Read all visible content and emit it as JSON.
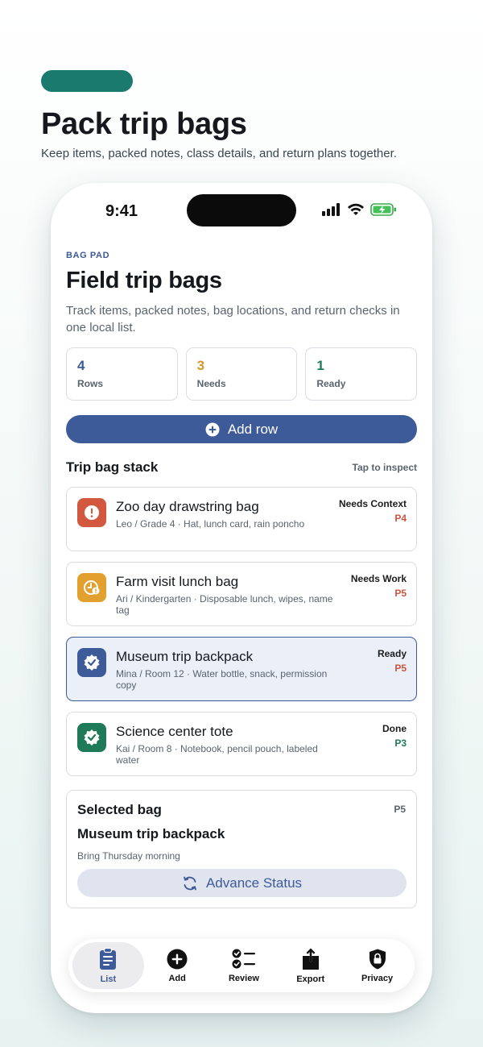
{
  "hero": {
    "title": "Pack trip bags",
    "subtitle": "Keep items, packed notes, class details, and return plans together."
  },
  "status_bar": {
    "time": "9:41"
  },
  "page": {
    "eyebrow": "BAG PAD",
    "title": "Field trip bags",
    "description": "Track items, packed notes, bag locations, and return checks in one local list."
  },
  "stats": [
    {
      "value": "4",
      "label": "Rows",
      "color": "#3d5a99"
    },
    {
      "value": "3",
      "label": "Needs",
      "color": "#d9962a"
    },
    {
      "value": "1",
      "label": "Ready",
      "color": "#1f7a5a"
    }
  ],
  "add_button": {
    "label": "Add row"
  },
  "section": {
    "title": "Trip bag stack",
    "hint": "Tap to inspect"
  },
  "rows": [
    {
      "title": "Zoo day drawstring bag",
      "meta": "Leo / Grade 4 · Hat, lunch card, rain poncho",
      "status": "Needs Context",
      "priority": "P4",
      "priority_color": "#c9553f",
      "icon": "alert-icon",
      "icon_bg": "#d25940"
    },
    {
      "title": "Farm visit lunch bag",
      "meta": "Ari / Kindergarten · Disposable lunch, wipes, name tag",
      "status": "Needs Work",
      "priority": "P5",
      "priority_color": "#c9553f",
      "icon": "clock-alert-icon",
      "icon_bg": "#e2a02f"
    },
    {
      "title": "Museum trip backpack",
      "meta": "Mina / Room 12 · Water bottle, snack, permission copy",
      "status": "Ready",
      "priority": "P5",
      "priority_color": "#c9553f",
      "icon": "check-badge-icon",
      "icon_bg": "#3d5a99"
    },
    {
      "title": "Science center tote",
      "meta": "Kai / Room 8 · Notebook, pencil pouch, labeled water",
      "status": "Done",
      "priority": "P3",
      "priority_color": "#1f7a5a",
      "icon": "check-badge-icon",
      "icon_bg": "#1f7a5a"
    }
  ],
  "detail": {
    "heading": "Selected bag",
    "priority": "P5",
    "name": "Museum trip backpack",
    "note": "Bring Thursday morning",
    "button_label": "Advance Status"
  },
  "tabs": [
    {
      "label": "List",
      "icon": "clipboard-icon",
      "active": true
    },
    {
      "label": "Add",
      "icon": "plus-circle-icon",
      "active": false
    },
    {
      "label": "Review",
      "icon": "checklist-icon",
      "active": false
    },
    {
      "label": "Export",
      "icon": "share-icon",
      "active": false
    },
    {
      "label": "Privacy",
      "icon": "lock-shield-icon",
      "active": false
    }
  ]
}
